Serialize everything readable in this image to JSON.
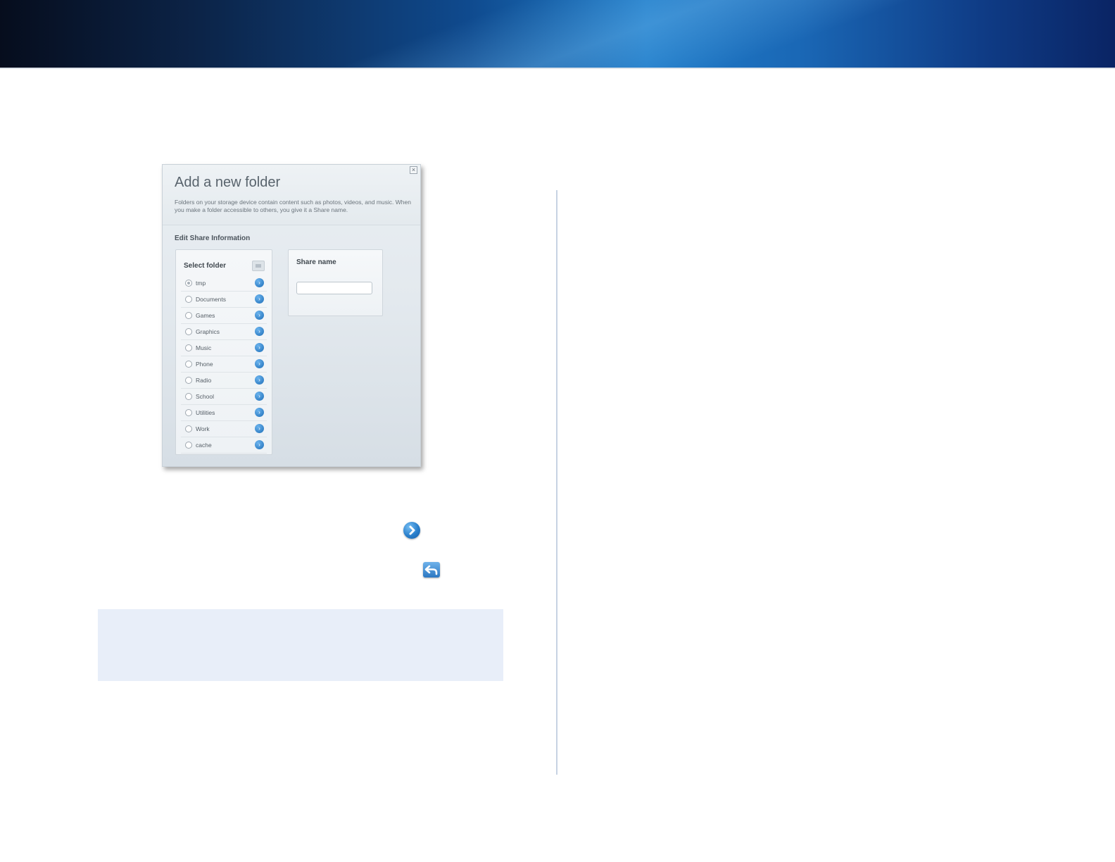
{
  "dialog": {
    "title": "Add a new folder",
    "description": "Folders on your storage device contain content such as photos, videos, and music. When you make a folder accessible to others, you give it a Share name.",
    "section_label": "Edit Share Information",
    "select_folder_label": "Select folder",
    "share_name_label": "Share name",
    "share_name_value": "",
    "close_glyph": "×",
    "folders": [
      {
        "name": "tmp",
        "selected": true
      },
      {
        "name": "Documents",
        "selected": false
      },
      {
        "name": "Games",
        "selected": false
      },
      {
        "name": "Graphics",
        "selected": false
      },
      {
        "name": "Music",
        "selected": false
      },
      {
        "name": "Phone",
        "selected": false
      },
      {
        "name": "Radio",
        "selected": false
      },
      {
        "name": "School",
        "selected": false
      },
      {
        "name": "Utilities",
        "selected": false
      },
      {
        "name": "Work",
        "selected": false
      },
      {
        "name": "cache",
        "selected": false
      }
    ]
  },
  "icons": {
    "go": "chevron-right-icon",
    "back": "back-arrow-icon",
    "new_folder": "folder-icon"
  },
  "colors": {
    "accent_blue": "#2a7fcb",
    "note_background": "#e8eef9",
    "divider": "#c7d3e3"
  }
}
